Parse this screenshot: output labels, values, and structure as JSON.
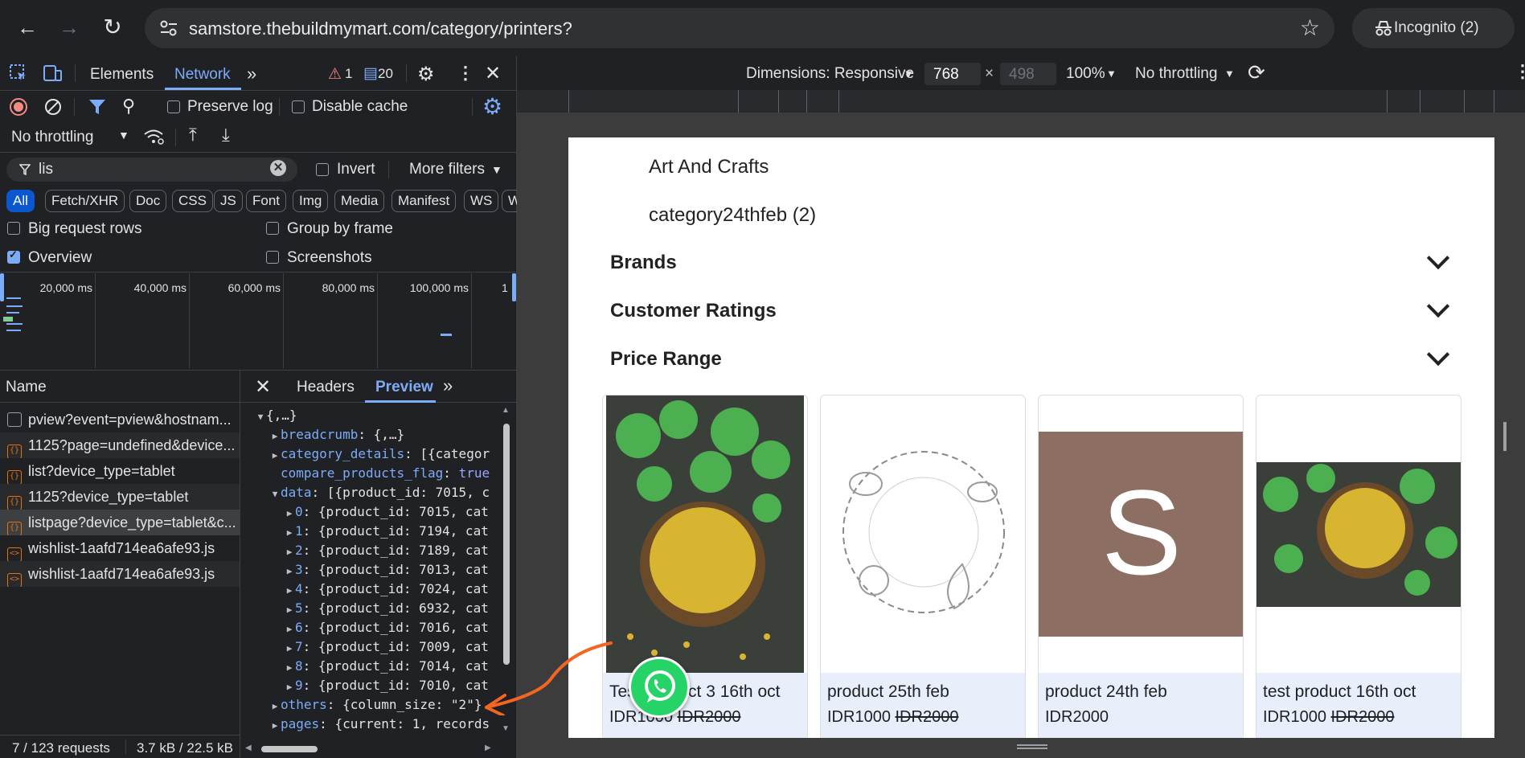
{
  "browser": {
    "url": "samstore.thebuildmymart.com/category/printers?",
    "incognito_label": "Incognito (2)"
  },
  "devtools": {
    "tabs": [
      "Elements",
      "Network"
    ],
    "active_tab": "Network",
    "warnings": "1",
    "messages": "20",
    "preserve_log": "Preserve log",
    "disable_cache": "Disable cache",
    "throttling": "No throttling",
    "filter_value": "lis",
    "invert": "Invert",
    "more_filters": "More filters",
    "type_chips": [
      "All",
      "Fetch/XHR",
      "Doc",
      "CSS",
      "JS",
      "Font",
      "Img",
      "Media",
      "Manifest",
      "WS",
      "W"
    ],
    "options": {
      "big_rows": "Big request rows",
      "group_by_frame": "Group by frame",
      "overview": "Overview",
      "screenshots": "Screenshots"
    },
    "timeline_ticks": [
      "20,000 ms",
      "40,000 ms",
      "60,000 ms",
      "80,000 ms",
      "100,000 ms",
      "1"
    ],
    "name_header": "Name",
    "requests": [
      {
        "name": "pview?event=pview&hostnam...",
        "type": "doc"
      },
      {
        "name": "1125?page=undefined&device...",
        "type": "xhr"
      },
      {
        "name": "list?device_type=tablet",
        "type": "xhr"
      },
      {
        "name": "1125?device_type=tablet",
        "type": "xhr"
      },
      {
        "name": "listpage?device_type=tablet&c...",
        "type": "xhr"
      },
      {
        "name": "wishlist-1aafd714ea6afe93.js",
        "type": "js"
      },
      {
        "name": "wishlist-1aafd714ea6afe93.js",
        "type": "js"
      }
    ],
    "detail_tabs": [
      "Headers",
      "Preview"
    ],
    "active_detail_tab": "Preview",
    "preview": {
      "root": "{,…}",
      "breadcrumb": {
        "key": "breadcrumb",
        "val": "{,…}"
      },
      "category_details": {
        "key": "category_details",
        "val": "[{categor"
      },
      "compare_products_flag": {
        "key": "compare_products_flag",
        "val": "true"
      },
      "data": {
        "key": "data",
        "val": "[{product_id: 7015, c"
      },
      "items": [
        {
          "idx": "0",
          "val": "{product_id: 7015, cat"
        },
        {
          "idx": "1",
          "val": "{product_id: 7194, cat"
        },
        {
          "idx": "2",
          "val": "{product_id: 7189, cat"
        },
        {
          "idx": "3",
          "val": "{product_id: 7013, cat"
        },
        {
          "idx": "4",
          "val": "{product_id: 7024, cat"
        },
        {
          "idx": "5",
          "val": "{product_id: 6932, cat"
        },
        {
          "idx": "6",
          "val": "{product_id: 7016, cat"
        },
        {
          "idx": "7",
          "val": "{product_id: 7009, cat"
        },
        {
          "idx": "8",
          "val": "{product_id: 7014, cat"
        },
        {
          "idx": "9",
          "val": "{product_id: 7010, cat"
        }
      ],
      "others": {
        "key": "others",
        "val": "{column_size: \"2\"}"
      },
      "pages": {
        "key": "pages",
        "val": "{current: 1, records"
      }
    },
    "status": {
      "requests": "7 / 123 requests",
      "size": "3.7 kB / 22.5 kB"
    }
  },
  "device_toolbar": {
    "dimensions": "Dimensions: Responsive",
    "width": "768",
    "x": "×",
    "height": "498",
    "zoom": "100%",
    "throttling": "No throttling"
  },
  "page": {
    "categories": [
      "Art And Crafts",
      "category24thfeb (2)"
    ],
    "accordions": [
      "Brands",
      "Customer Ratings",
      "Price Range"
    ],
    "products": [
      {
        "name": "Test product 3 16th oct",
        "price": "IDR1000",
        "old_price": "IDR2000",
        "image": "fenugreek-photo"
      },
      {
        "name": "product 25th feb",
        "price": "IDR1000",
        "old_price": "IDR2000",
        "image": "food-sketch"
      },
      {
        "name": "product 24th feb",
        "price": "IDR2000",
        "old_price": "",
        "image": "letter-s"
      },
      {
        "name": "test product 16th oct",
        "price": "IDR1000",
        "old_price": "IDR2000",
        "image": "fenugreek-photo"
      }
    ],
    "placeholder_letter": "S"
  },
  "colors": {
    "accent": "#7cacf8",
    "active_chip": "#0b57d0",
    "annotation_arrow": "#f26522",
    "whatsapp": "#25d366",
    "placeholder_bg": "#8d6e63"
  }
}
